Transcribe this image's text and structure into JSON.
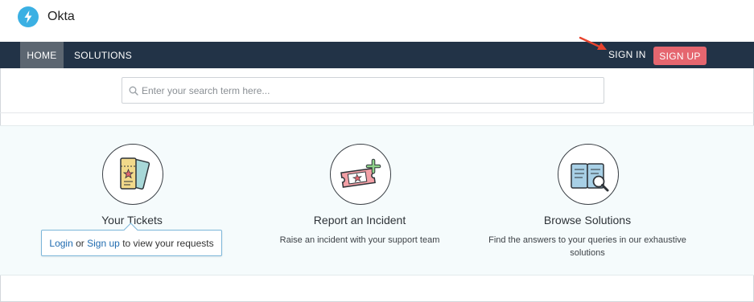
{
  "brand": {
    "name": "Okta",
    "logo_icon": "lightning-bolt-icon",
    "logo_color": "#3bb0e3"
  },
  "nav": {
    "home": "HOME",
    "solutions": "SOLUTIONS",
    "sign_in": "SIGN IN",
    "sign_up": "SIGN UP",
    "bar_color": "#223347",
    "signup_color": "#e5666f"
  },
  "search": {
    "placeholder": "Enter your search term here...",
    "icon": "search-icon"
  },
  "cards": [
    {
      "title": "Your Tickets",
      "icon": "tickets-icon",
      "description": ""
    },
    {
      "title": "Report an Incident",
      "icon": "ticket-plus-icon",
      "description": "Raise an incident with your support team"
    },
    {
      "title": "Browse Solutions",
      "icon": "book-search-icon",
      "description": "Find the answers to your queries in our exhaustive solutions"
    }
  ],
  "popover": {
    "login": "Login",
    "or": "or",
    "signup": "Sign up",
    "suffix": "to view your requests"
  },
  "annotation": {
    "arrow_color": "#e8442e"
  }
}
